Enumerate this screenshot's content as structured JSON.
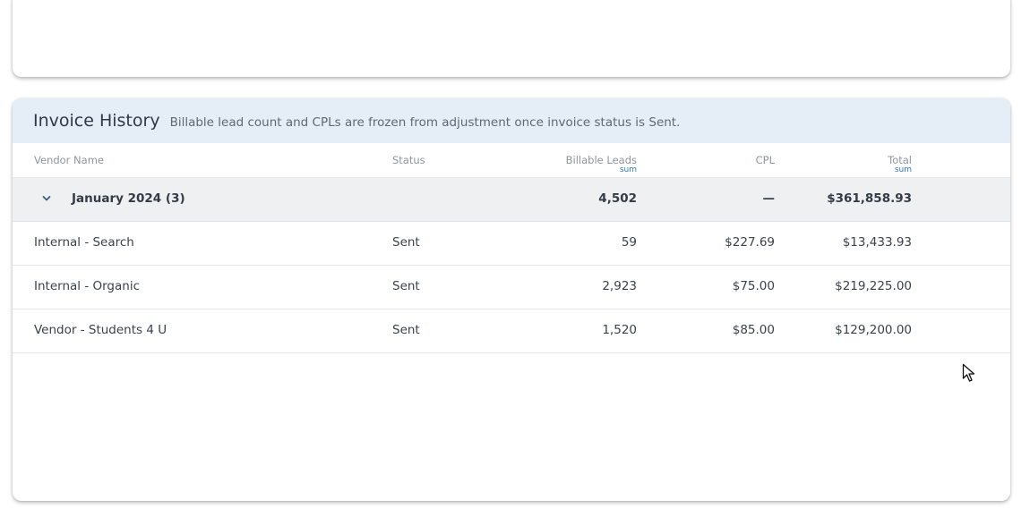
{
  "invoice_history": {
    "title": "Invoice History",
    "subtitle": "Billable lead count and CPLs are frozen from adjustment once invoice status is Sent.",
    "columns": {
      "vendor": "Vendor Name",
      "status": "Status",
      "leads": "Billable Leads",
      "leads_agg": "sum",
      "cpl": "CPL",
      "total": "Total",
      "total_agg": "sum"
    },
    "group": {
      "label": "January 2024 (3)",
      "leads": "4,502",
      "cpl": "—",
      "total": "$361,858.93"
    },
    "rows": [
      {
        "vendor": "Internal - Search",
        "status": "Sent",
        "leads": "59",
        "cpl": "$227.69",
        "total": "$13,433.93"
      },
      {
        "vendor": "Internal - Organic",
        "status": "Sent",
        "leads": "2,923",
        "cpl": "$75.00",
        "total": "$219,225.00"
      },
      {
        "vendor": "Vendor - Students 4 U",
        "status": "Sent",
        "leads": "1,520",
        "cpl": "$85.00",
        "total": "$129,200.00"
      }
    ]
  },
  "colors": {
    "header_bg": "#e5eef6",
    "group_row_bg": "#eef0f2",
    "aggregate_label": "#2f77c6"
  },
  "icons": {
    "group_toggle": "chevron-down-icon",
    "pointer": "mouse-cursor-icon"
  }
}
